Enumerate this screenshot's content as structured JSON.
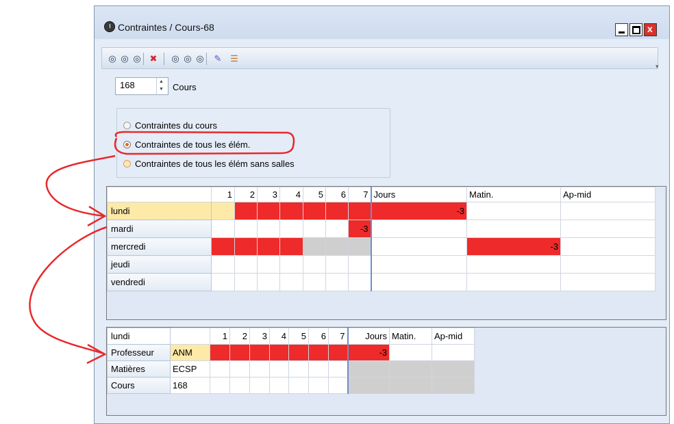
{
  "window": {
    "title": "Contraintes / Cours-68",
    "icon": "clock-icon"
  },
  "toolbar": {
    "buttons": [
      {
        "name": "tb-btn-1",
        "glyph": "◎"
      },
      {
        "name": "tb-btn-2",
        "glyph": "◎"
      },
      {
        "name": "tb-btn-3",
        "glyph": "◎"
      },
      {
        "name": "tb-delete",
        "glyph": "✖"
      },
      {
        "name": "tb-btn-5",
        "glyph": "◎"
      },
      {
        "name": "tb-btn-6",
        "glyph": "◎"
      },
      {
        "name": "tb-btn-7",
        "glyph": "◎"
      },
      {
        "name": "tb-edit",
        "glyph": "✎"
      },
      {
        "name": "tb-list",
        "glyph": "☰"
      }
    ]
  },
  "spinner": {
    "value": "168",
    "label": "Cours"
  },
  "radios": [
    {
      "label": "Contraintes du cours",
      "checked": false
    },
    {
      "label": "Contraintes de tous les élém.",
      "checked": true
    },
    {
      "label": "Contraintes de tous les élém sans salles",
      "checked": false
    }
  ],
  "grid1": {
    "headers": [
      "",
      "1",
      "2",
      "3",
      "4",
      "5",
      "6",
      "7",
      "Jours",
      "Matin.",
      "Ap-mid"
    ],
    "rows": [
      {
        "day": "lundi",
        "slots": [
          "gold",
          "red",
          "red",
          "red",
          "red",
          "red",
          "red"
        ],
        "slot_labels": [
          "",
          "",
          "",
          "",
          "",
          "",
          ""
        ],
        "jours": "-3",
        "jours_red": true,
        "matin": "",
        "matin_red": false,
        "apmid": ""
      },
      {
        "day": "mardi",
        "slots": [
          "",
          "",
          "",
          "",
          "",
          "",
          "red"
        ],
        "slot_labels": [
          "",
          "",
          "",
          "",
          "",
          "",
          "-3"
        ],
        "jours": "",
        "jours_red": false,
        "matin": "",
        "matin_red": false,
        "apmid": ""
      },
      {
        "day": "mercredi",
        "slots": [
          "red",
          "red",
          "red",
          "red",
          "gray",
          "gray",
          "gray"
        ],
        "slot_labels": [
          "",
          "",
          "",
          "",
          "",
          "",
          ""
        ],
        "jours": "",
        "jours_red": false,
        "matin": "-3",
        "matin_red": true,
        "apmid": ""
      },
      {
        "day": "jeudi",
        "slots": [
          "",
          "",
          "",
          "",
          "",
          "",
          ""
        ],
        "slot_labels": [
          "",
          "",
          "",
          "",
          "",
          "",
          ""
        ],
        "jours": "",
        "jours_red": false,
        "matin": "",
        "matin_red": false,
        "apmid": ""
      },
      {
        "day": "vendredi",
        "slots": [
          "",
          "",
          "",
          "",
          "",
          "",
          ""
        ],
        "slot_labels": [
          "",
          "",
          "",
          "",
          "",
          "",
          ""
        ],
        "jours": "",
        "jours_red": false,
        "matin": "",
        "matin_red": false,
        "apmid": ""
      }
    ]
  },
  "grid2": {
    "headers": [
      "lundi",
      "",
      "1",
      "2",
      "3",
      "4",
      "5",
      "6",
      "7",
      "Jours",
      "Matin.",
      "Ap-mid"
    ],
    "rows": [
      {
        "label": "Professeur",
        "value": "ANM",
        "value_gold": true,
        "slots": [
          "red",
          "red",
          "red",
          "red",
          "red",
          "red",
          "red"
        ],
        "jours": "-3",
        "jours_red": true,
        "gray_tail": false
      },
      {
        "label": "Matières",
        "value": "ECSP",
        "value_gold": false,
        "slots": [
          "",
          "",
          "",
          "",
          "",
          "",
          ""
        ],
        "jours": "",
        "jours_red": false,
        "gray_tail": true
      },
      {
        "label": "Cours",
        "value": "168",
        "value_gold": false,
        "slots": [
          "",
          "",
          "",
          "",
          "",
          "",
          ""
        ],
        "jours": "",
        "jours_red": false,
        "gray_tail": true
      }
    ]
  },
  "colors": {
    "red": "#ee2a2a",
    "gold": "#fde9a8",
    "gray": "#cfcfcf",
    "annotation": "#e8282a"
  }
}
